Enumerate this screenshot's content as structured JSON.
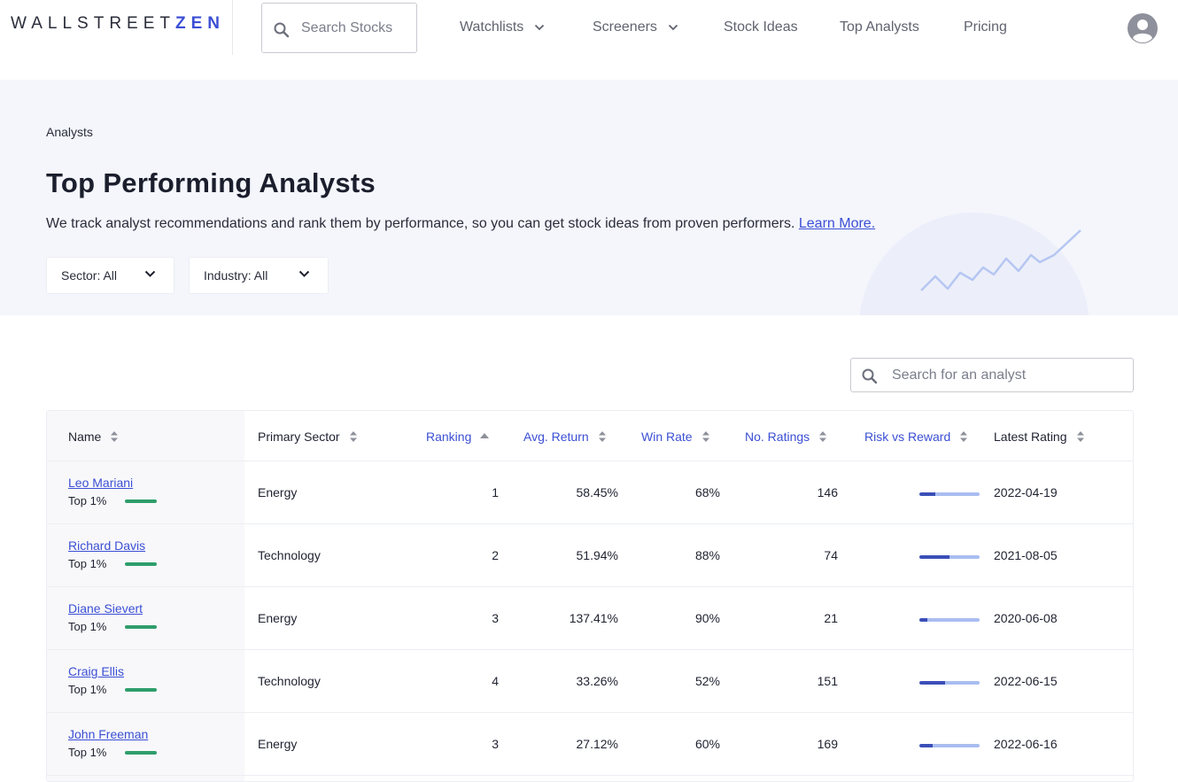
{
  "brand": {
    "wall": "WALLSTREET",
    "zen": "ZEN"
  },
  "nav": {
    "search_placeholder": "Search Stocks",
    "items": [
      "Watchlists",
      "Screeners",
      "Stock Ideas",
      "Top Analysts",
      "Pricing"
    ]
  },
  "hero": {
    "breadcrumb": "Analysts",
    "title": "Top Performing Analysts",
    "description": "We track analyst recommendations and rank them by performance, so you can get stock ideas from proven performers.",
    "learn_more": "Learn More.",
    "filters": {
      "sector": "Sector: All",
      "industry": "Industry: All"
    }
  },
  "analyst_search": {
    "placeholder": "Search for an analyst"
  },
  "table": {
    "columns": [
      "Name",
      "Primary Sector",
      "Ranking",
      "Avg. Return",
      "Win Rate",
      "No. Ratings",
      "Risk vs Reward",
      "Latest Rating"
    ],
    "rows": [
      {
        "name": "Leo Mariani",
        "tier": "Top 1%",
        "sector": "Energy",
        "ranking": "1",
        "avg_return": "58.45%",
        "win_rate": "68%",
        "ratings": "146",
        "risk_reward": 0.27,
        "latest": "2022-04-19"
      },
      {
        "name": "Richard Davis",
        "tier": "Top 1%",
        "sector": "Technology",
        "ranking": "2",
        "avg_return": "51.94%",
        "win_rate": "88%",
        "ratings": "74",
        "risk_reward": 0.5,
        "latest": "2021-08-05"
      },
      {
        "name": "Diane Sievert",
        "tier": "Top 1%",
        "sector": "Energy",
        "ranking": "3",
        "avg_return": "137.41%",
        "win_rate": "90%",
        "ratings": "21",
        "risk_reward": 0.13,
        "latest": "2020-06-08"
      },
      {
        "name": "Craig Ellis",
        "tier": "Top 1%",
        "sector": "Technology",
        "ranking": "4",
        "avg_return": "33.26%",
        "win_rate": "52%",
        "ratings": "151",
        "risk_reward": 0.43,
        "latest": "2022-06-15"
      },
      {
        "name": "John Freeman",
        "tier": "Top 1%",
        "sector": "Energy",
        "ranking": "3",
        "avg_return": "27.12%",
        "win_rate": "60%",
        "ratings": "169",
        "risk_reward": 0.22,
        "latest": "2022-06-16"
      }
    ]
  },
  "colors": {
    "accent": "#3b4fd4",
    "tier_green": "#2f9e6b",
    "hero_bg": "#f4f6fc"
  }
}
